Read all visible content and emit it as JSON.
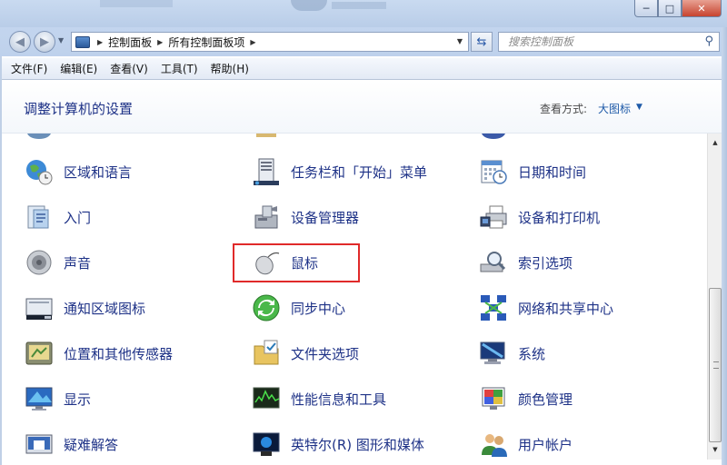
{
  "window": {
    "min": "─",
    "max": "□",
    "close": "✕"
  },
  "address": {
    "crumbs": [
      "控制面板",
      "所有控制面板项"
    ]
  },
  "search": {
    "placeholder": "搜索控制面板"
  },
  "menu": [
    "文件(F)",
    "编辑(E)",
    "查看(V)",
    "工具(T)",
    "帮助(H)"
  ],
  "header": {
    "title": "调整计算机的设置",
    "view_label": "查看方式:",
    "view_value": "大图标"
  },
  "items": [
    {
      "label": "区域和语言",
      "icon": "globe-clock-icon"
    },
    {
      "label": "任务栏和「开始」菜单",
      "icon": "taskbar-icon"
    },
    {
      "label": "日期和时间",
      "icon": "calendar-clock-icon"
    },
    {
      "label": "入门",
      "icon": "getting-started-icon"
    },
    {
      "label": "设备管理器",
      "icon": "device-manager-icon"
    },
    {
      "label": "设备和打印机",
      "icon": "printer-icon"
    },
    {
      "label": "声音",
      "icon": "speaker-icon"
    },
    {
      "label": "鼠标",
      "icon": "mouse-icon"
    },
    {
      "label": "索引选项",
      "icon": "index-search-icon"
    },
    {
      "label": "通知区域图标",
      "icon": "notification-area-icon"
    },
    {
      "label": "同步中心",
      "icon": "sync-center-icon"
    },
    {
      "label": "网络和共享中心",
      "icon": "network-icon"
    },
    {
      "label": "位置和其他传感器",
      "icon": "location-sensor-icon"
    },
    {
      "label": "文件夹选项",
      "icon": "folder-options-icon"
    },
    {
      "label": "系统",
      "icon": "system-icon"
    },
    {
      "label": "显示",
      "icon": "display-icon"
    },
    {
      "label": "性能信息和工具",
      "icon": "performance-icon"
    },
    {
      "label": "颜色管理",
      "icon": "color-management-icon"
    },
    {
      "label": "疑难解答",
      "icon": "troubleshooting-icon"
    },
    {
      "label": "英特尔(R) 图形和媒体",
      "icon": "intel-graphics-icon"
    },
    {
      "label": "用户帐户",
      "icon": "user-accounts-icon"
    }
  ],
  "scrollbar": {
    "up": "▲",
    "down": "▼"
  }
}
